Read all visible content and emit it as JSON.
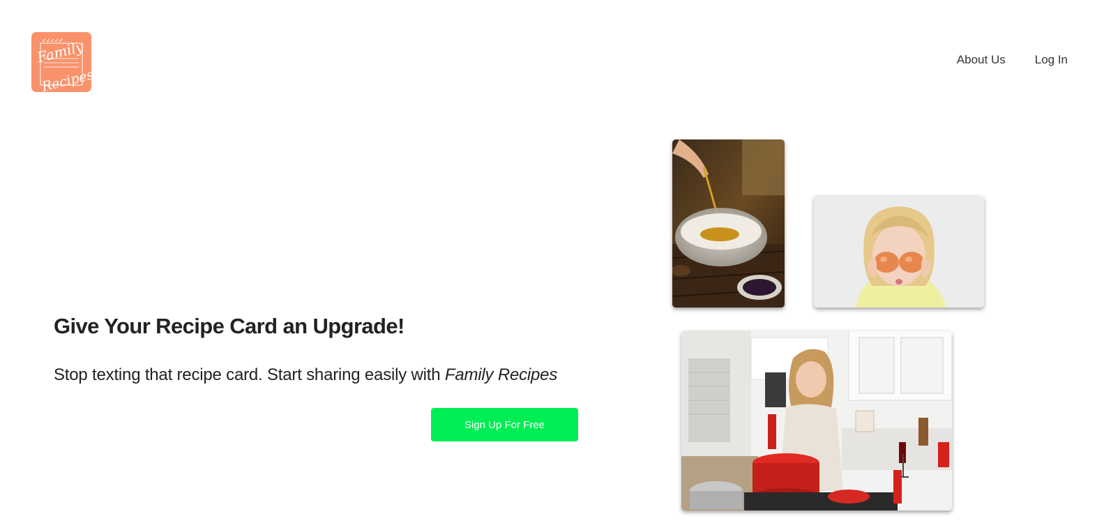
{
  "header": {
    "logo_text": [
      "Family",
      "Recipes"
    ],
    "nav": [
      {
        "label": "About Us"
      },
      {
        "label": "Log In"
      }
    ]
  },
  "hero": {
    "headline": "Give Your Recipe Card an Upgrade!",
    "subline_prefix": "Stop texting that recipe card. Start sharing easily with ",
    "subline_brand": "Family Recipes",
    "cta_label": "Sign Up For Free"
  },
  "colors": {
    "logo_bg": "#f9926b",
    "cta_bg": "#00ee55",
    "text": "#222222"
  },
  "images": [
    {
      "name": "spice-bowl-photo"
    },
    {
      "name": "girl-with-eggs-photo"
    },
    {
      "name": "woman-cooking-kitchen-photo"
    }
  ]
}
